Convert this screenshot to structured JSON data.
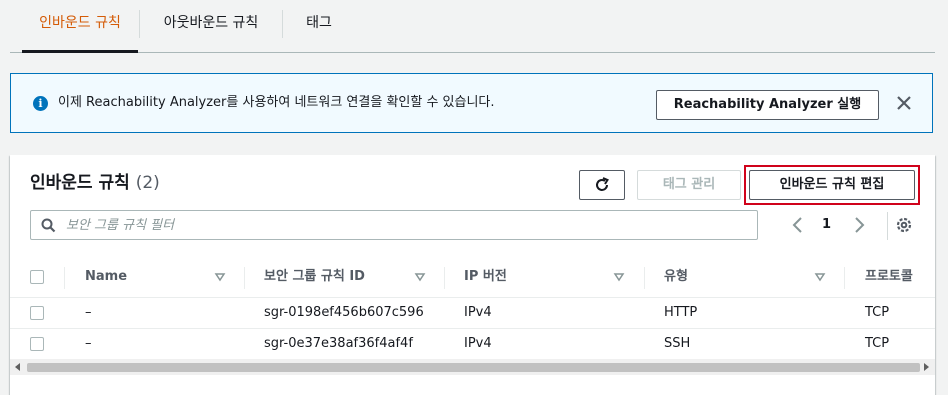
{
  "tabs": [
    {
      "label": "인바운드 규칙"
    },
    {
      "label": "아웃바운드 규칙"
    },
    {
      "label": "태그"
    }
  ],
  "flash": {
    "icon": "info-icon",
    "message": "이제 Reachability Analyzer를 사용하여 네트워크 연결을 확인할 수 있습니다.",
    "button_label": "Reachability Analyzer 실행",
    "close_icon": "close-icon"
  },
  "panel": {
    "title": "인바운드 규칙",
    "count": "(2)",
    "refresh_icon": "refresh-icon",
    "manage_tags_label": "태그 관리",
    "edit_rules_label": "인바운드 규칙 편집",
    "search_placeholder": "보안 그룹 규칙 필터",
    "page": "1"
  },
  "table": {
    "headers": {
      "name": "Name",
      "rule_id": "보안 그룹 규칙 ID",
      "ip_version": "IP 버전",
      "type": "유형",
      "protocol": "프로토콜"
    },
    "rows": [
      {
        "name": "–",
        "rule_id": "sgr-0198ef456b607c596",
        "ip_version": "IPv4",
        "type": "HTTP",
        "protocol": "TCP"
      },
      {
        "name": "–",
        "rule_id": "sgr-0e37e38af36f4af4f",
        "ip_version": "IPv4",
        "type": "SSH",
        "protocol": "TCP"
      }
    ]
  },
  "colors": {
    "active_tab": "#d45b07",
    "info_blue": "#0073bb",
    "highlight_red": "#d0021b"
  }
}
